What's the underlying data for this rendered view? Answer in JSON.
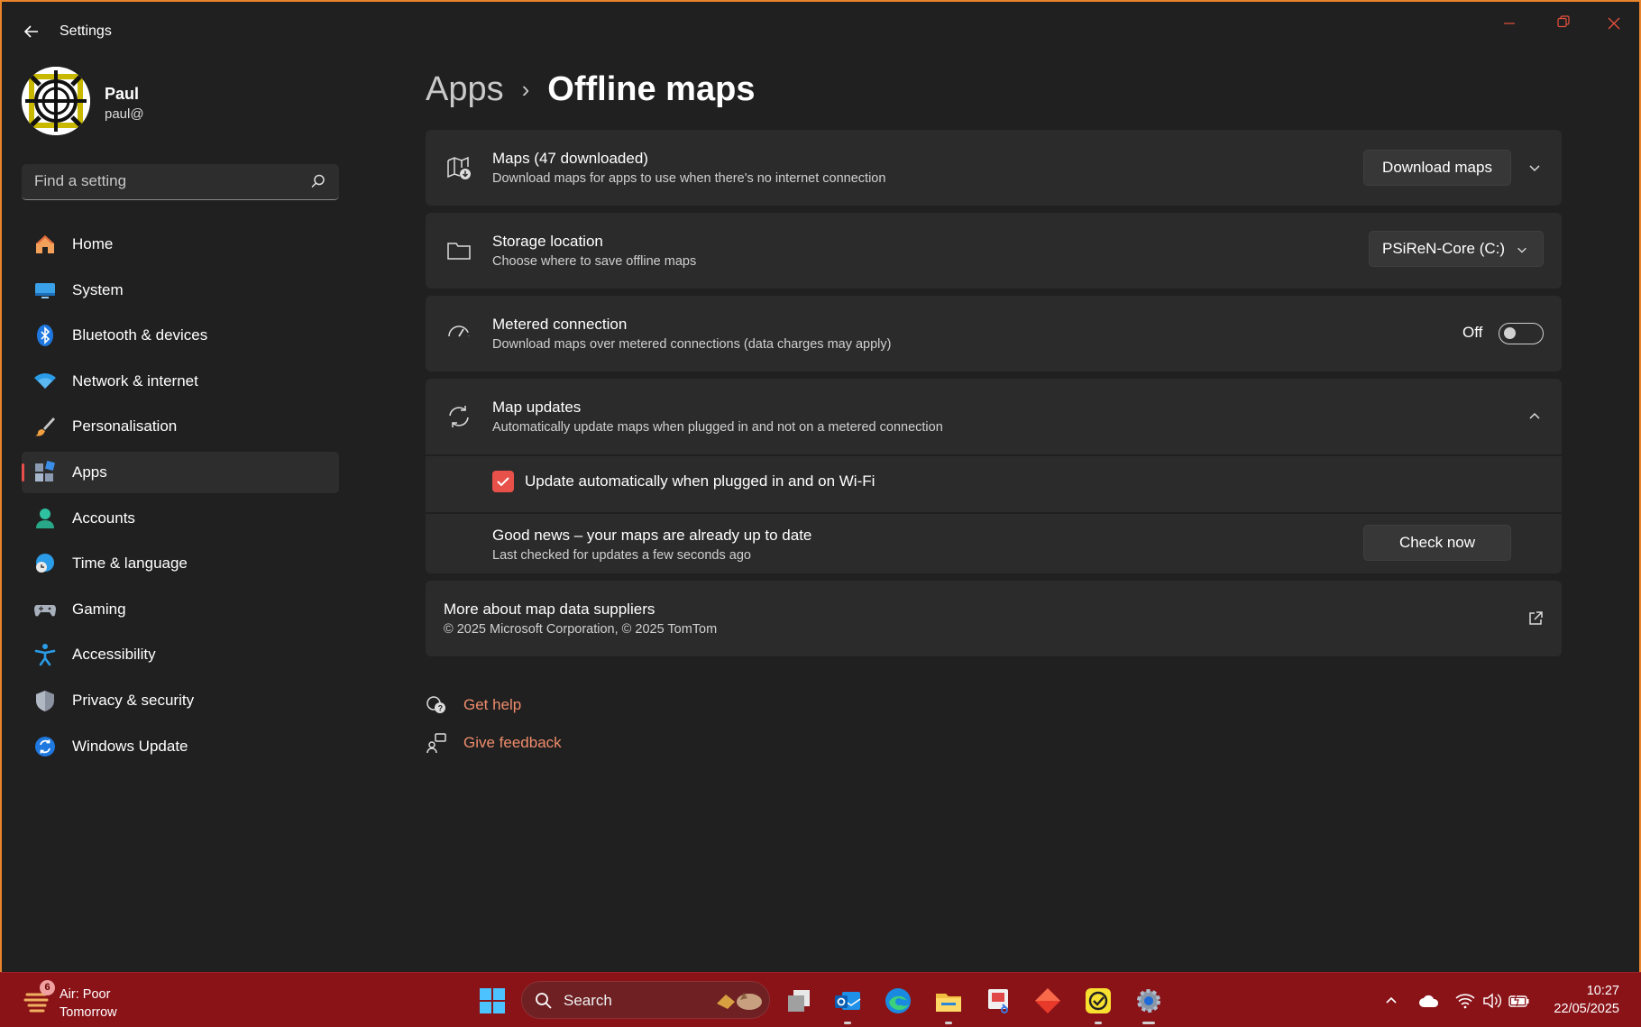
{
  "window": {
    "title": "Settings",
    "accent_color": "#e8504a",
    "border_color": "#e8842c"
  },
  "profile": {
    "name": "Paul",
    "email": "paul@"
  },
  "search": {
    "placeholder": "Find a setting"
  },
  "sidebar": {
    "items": [
      {
        "label": "Home",
        "icon": "home-icon"
      },
      {
        "label": "System",
        "icon": "system-icon"
      },
      {
        "label": "Bluetooth & devices",
        "icon": "bluetooth-icon"
      },
      {
        "label": "Network & internet",
        "icon": "wifi-icon"
      },
      {
        "label": "Personalisation",
        "icon": "brush-icon"
      },
      {
        "label": "Apps",
        "icon": "apps-icon",
        "selected": true
      },
      {
        "label": "Accounts",
        "icon": "person-icon"
      },
      {
        "label": "Time & language",
        "icon": "globe-clock-icon"
      },
      {
        "label": "Gaming",
        "icon": "controller-icon"
      },
      {
        "label": "Accessibility",
        "icon": "accessibility-icon"
      },
      {
        "label": "Privacy & security",
        "icon": "shield-icon"
      },
      {
        "label": "Windows Update",
        "icon": "update-icon"
      }
    ]
  },
  "breadcrumb": {
    "parent": "Apps",
    "separator": "›",
    "current": "Offline maps"
  },
  "maps_card": {
    "title": "Maps (47 downloaded)",
    "description": "Download maps for apps to use when there's no internet connection",
    "button_label": "Download maps"
  },
  "storage_card": {
    "title": "Storage location",
    "description": "Choose where to save offline maps",
    "selected_drive": "PSiReN-Core (C:)"
  },
  "metered_card": {
    "title": "Metered connection",
    "description": "Download maps over metered connections (data charges may apply)",
    "toggle_state": "Off"
  },
  "updates_card": {
    "title": "Map updates",
    "description": "Automatically update maps when plugged in and not on a metered connection",
    "checkbox_label": "Update automatically when plugged in and on Wi-Fi",
    "checkbox_checked": true,
    "status_title": "Good news – your maps are already up to date",
    "status_desc": "Last checked for updates a few seconds ago",
    "check_button": "Check now"
  },
  "suppliers_card": {
    "title": "More about map data suppliers",
    "description": "© 2025 Microsoft Corporation, © 2025 TomTom"
  },
  "help": {
    "get_help": "Get help",
    "give_feedback": "Give feedback"
  },
  "taskbar": {
    "weather_badge": "6",
    "weather_line1": "Air: Poor",
    "weather_line2": "Tomorrow",
    "search_label": "Search",
    "time": "10:27",
    "date": "22/05/2025",
    "color": "#8a1318"
  }
}
